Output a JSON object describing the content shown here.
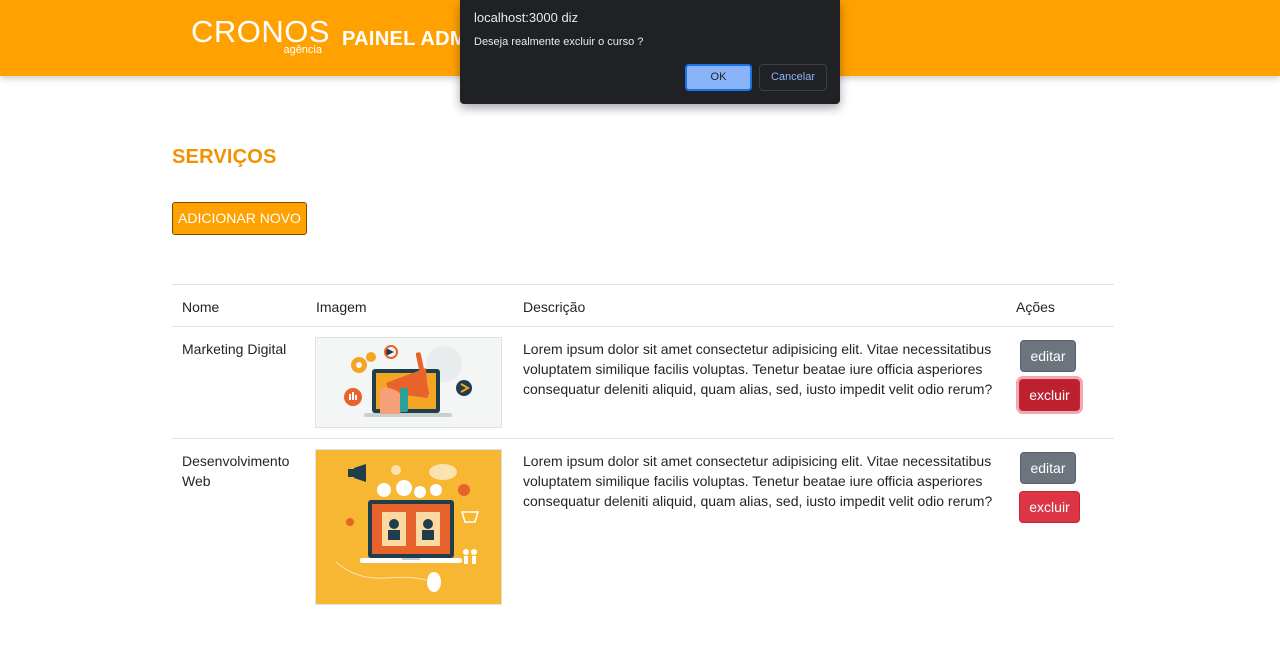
{
  "header": {
    "logo_text": "CRONOS",
    "logo_subtext": "agência",
    "panel_title": "PAINEL ADM"
  },
  "main": {
    "section_title": "SERVIÇOS",
    "add_button": "ADICIONAR NOVO",
    "table": {
      "columns": [
        "Nome",
        "Imagem",
        "Descrição",
        "Ações"
      ],
      "rows": [
        {
          "name": "Marketing Digital",
          "image": "marketing-illustration",
          "description": "Lorem ipsum dolor sit amet consectetur adipisicing elit. Vitae necessitatibus voluptatem similique facilis voluptas. Tenetur beatae iure officia asperiores consequatur deleniti aliquid, quam alias, sed, iusto impedit velit odio rerum?",
          "edit": "editar",
          "delete": "excluir"
        },
        {
          "name": "Desenvolvimento Web",
          "image": "web-development-illustration",
          "description": "Lorem ipsum dolor sit amet consectetur adipisicing elit. Vitae necessitatibus voluptatem similique facilis voluptas. Tenetur beatae iure officia asperiores consequatur deleniti aliquid, quam alias, sed, iusto impedit velit odio rerum?",
          "edit": "editar",
          "delete": "excluir"
        }
      ]
    }
  },
  "dialog": {
    "title": "localhost:3000 diz",
    "message": "Deseja realmente excluir o curso ?",
    "ok_label": "OK",
    "cancel_label": "Cancelar"
  },
  "colors": {
    "brand": "#ffa100",
    "title": "#f29200",
    "edit": "#6c757d",
    "delete": "#dc3545",
    "dialog_bg": "#202124",
    "dialog_accent": "#8ab4f8"
  }
}
